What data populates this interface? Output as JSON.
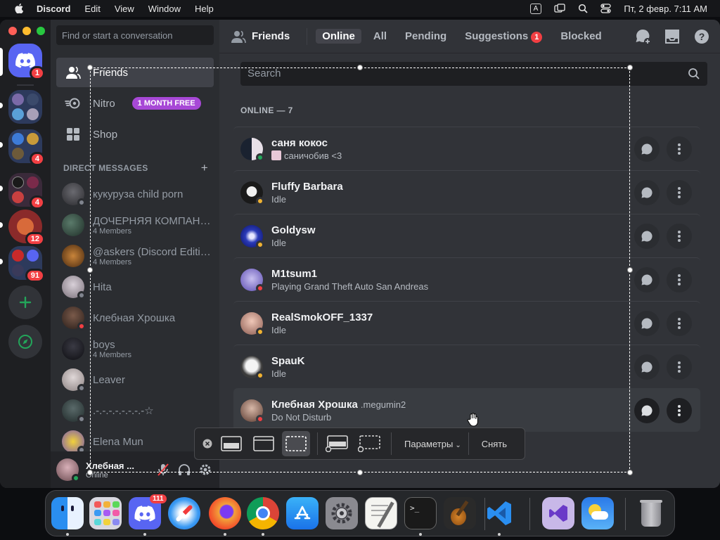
{
  "menubar": {
    "app_name": "Discord",
    "items": [
      "Edit",
      "View",
      "Window",
      "Help"
    ],
    "input_indicator": "A",
    "datetime": "Пт, 2 февр. 7:11 AM"
  },
  "guilds": {
    "home_badge": "1",
    "server_badges": [
      "4",
      "4",
      "12",
      "91"
    ]
  },
  "sidebar": {
    "search_placeholder": "Find or start a conversation",
    "nav": [
      {
        "label": "Friends"
      },
      {
        "label": "Nitro",
        "badge": "1 MONTH FREE"
      },
      {
        "label": "Shop"
      }
    ],
    "dm_header": "DIRECT MESSAGES",
    "dms": [
      {
        "name": "кукуруза child porn",
        "sub": "",
        "status": "offline"
      },
      {
        "name": "ДОЧЕРНЯЯ КОМПАНИЯ",
        "sub": "4 Members",
        "status": ""
      },
      {
        "name": "@askers (Discord Edition)",
        "sub": "4 Members",
        "status": ""
      },
      {
        "name": "Hita",
        "sub": "",
        "status": "offline"
      },
      {
        "name": "Клебная Хрошка",
        "sub": "",
        "status": "dnd"
      },
      {
        "name": "boys",
        "sub": "4 Members",
        "status": ""
      },
      {
        "name": "Leaver",
        "sub": "",
        "status": "offline"
      },
      {
        "name": ".-.-.-.-.-.-.-.-☆",
        "sub": "",
        "status": "offline"
      },
      {
        "name": "Elena Mun",
        "sub": "",
        "status": "offline"
      }
    ]
  },
  "userpanel": {
    "name": "Хлебная ...",
    "status": "Online"
  },
  "topbar": {
    "title": "Friends",
    "tabs": [
      "Online",
      "All",
      "Pending",
      "Suggestions",
      "Blocked"
    ],
    "suggestions_count": "1"
  },
  "main": {
    "search_placeholder": "Search",
    "online_header": "ONLINE — 7",
    "friends": [
      {
        "name": "саня кокос",
        "username": "",
        "status_text": "саничобив <3",
        "status": "online"
      },
      {
        "name": "Fluffy Barbara",
        "username": "",
        "status_text": "Idle",
        "status": "idle"
      },
      {
        "name": "Goldysw",
        "username": "",
        "status_text": "Idle",
        "status": "idle"
      },
      {
        "name": "M1tsum1",
        "username": "",
        "status_text": "Playing Grand Theft Auto San Andreas",
        "status": "dnd"
      },
      {
        "name": "RealSmokOFF_1337",
        "username": "",
        "status_text": "Idle",
        "status": "idle"
      },
      {
        "name": "SpauK",
        "username": "",
        "status_text": "Idle",
        "status": "idle"
      },
      {
        "name": "Клебная Хрошка",
        "username": ".megumin2",
        "status_text": "Do Not Disturb",
        "status": "dnd"
      }
    ]
  },
  "screenshot_toolbar": {
    "options_label": "Параметры",
    "capture_label": "Снять"
  },
  "dock": {
    "discord_badge": "111",
    "apps": [
      "finder-icon",
      "launchpad-icon",
      "discord-icon",
      "safari-icon",
      "firefox-icon",
      "chrome-icon",
      "app-store-icon",
      "system-settings-icon",
      "textedit-icon",
      "terminal-icon",
      "garageband-icon",
      "vscode-icon",
      "visual-studio-icon",
      "weather-icon",
      "trash-icon"
    ]
  },
  "colors": {
    "online": "#23a55a",
    "idle": "#f0b232",
    "dnd": "#f23f43",
    "offline": "#80848e",
    "blurple": "#5865f2",
    "nitro": "#a748d6"
  }
}
